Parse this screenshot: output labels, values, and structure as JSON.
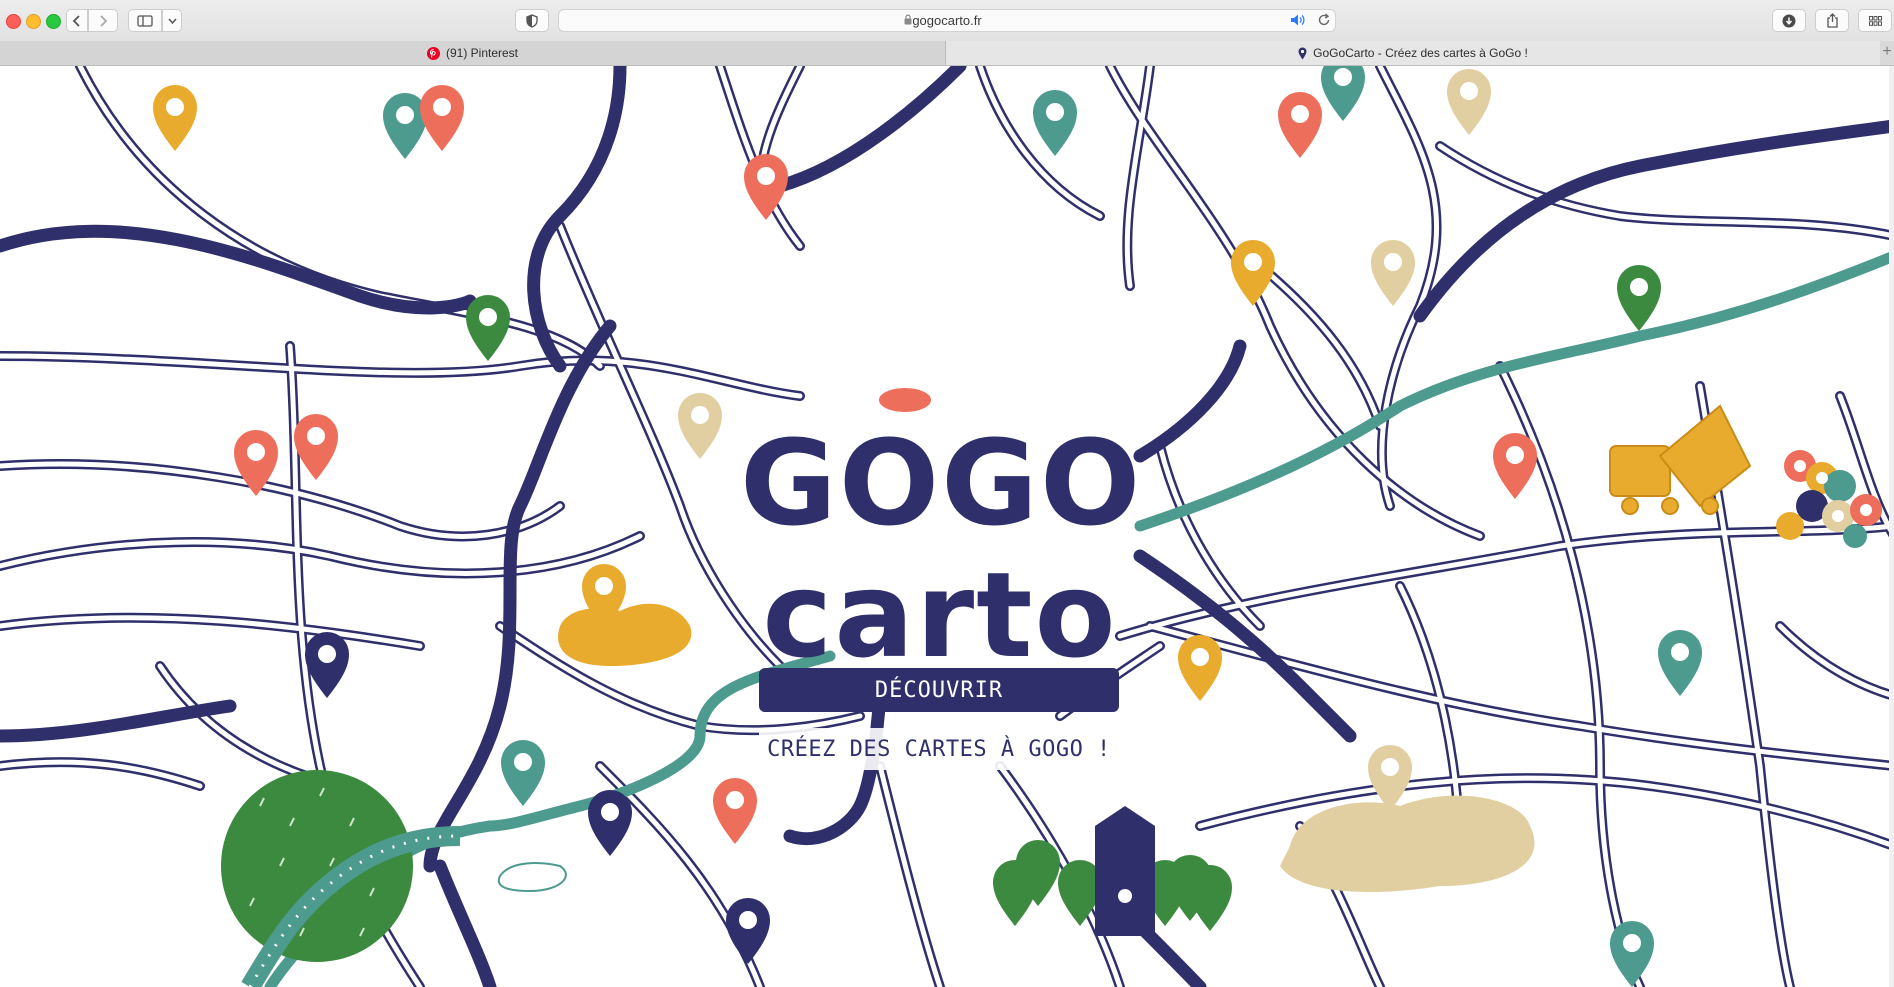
{
  "browser": {
    "url": "gogocarto.fr",
    "tabs": [
      {
        "title": "(91) Pinterest",
        "icon": "pinterest-icon"
      },
      {
        "title": "GoGoCarto - Créez des cartes à GoGo !",
        "icon": "map-pin-icon"
      }
    ],
    "new_tab_symbol": "+"
  },
  "page": {
    "logo_line_1": "GOGO",
    "logo_line_2": "carto",
    "discover_button": "DÉCOUVRIR",
    "tagline": "CRÉEZ DES CARTES À GOGO !"
  },
  "colors": {
    "navy": "#2f306b",
    "coral": "#ee6e5c",
    "mustard": "#e9ab2e",
    "teal": "#4d9a8e",
    "sand": "#e2cfa1",
    "green": "#3b8a3f"
  }
}
